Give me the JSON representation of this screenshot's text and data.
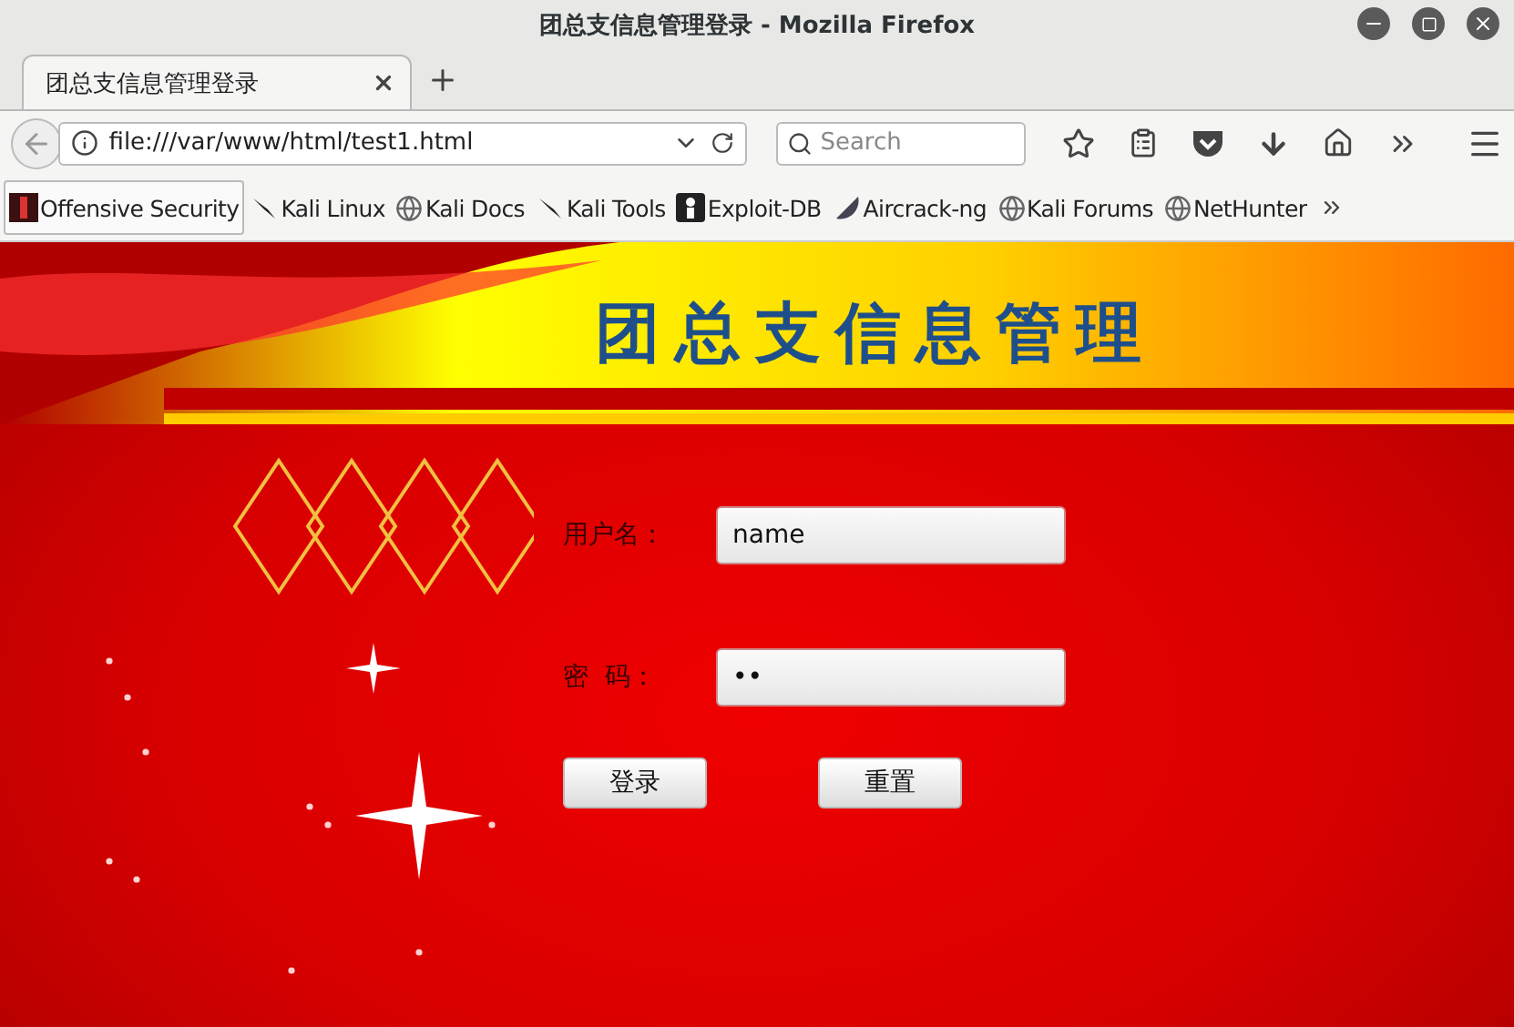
{
  "window": {
    "title": "团总支信息管理登录 - Mozilla Firefox"
  },
  "tabs": [
    {
      "label": "团总支信息管理登录",
      "selected": true
    }
  ],
  "address_bar": {
    "value": "file:///var/www/html/test1.html"
  },
  "search": {
    "placeholder": "Search"
  },
  "bookmarks": [
    {
      "label": "Offensive Security",
      "kind": "offsec",
      "selected": true
    },
    {
      "label": "Kali Linux",
      "kind": "kali",
      "selected": false
    },
    {
      "label": "Kali Docs",
      "kind": "globe",
      "selected": false
    },
    {
      "label": "Kali Tools",
      "kind": "kali",
      "selected": false
    },
    {
      "label": "Exploit-DB",
      "kind": "exploit",
      "selected": false
    },
    {
      "label": "Aircrack-ng",
      "kind": "aircrack",
      "selected": false
    },
    {
      "label": "Kali Forums",
      "kind": "globe",
      "selected": false
    },
    {
      "label": "NetHunter",
      "kind": "globe",
      "selected": false
    }
  ],
  "page": {
    "banner_title": "团总支信息管理",
    "fields": [
      {
        "label": "用户名：",
        "value": "name"
      },
      {
        "label": "密  码：",
        "value": "••"
      }
    ],
    "buttons": [
      "登录",
      "重置"
    ]
  }
}
